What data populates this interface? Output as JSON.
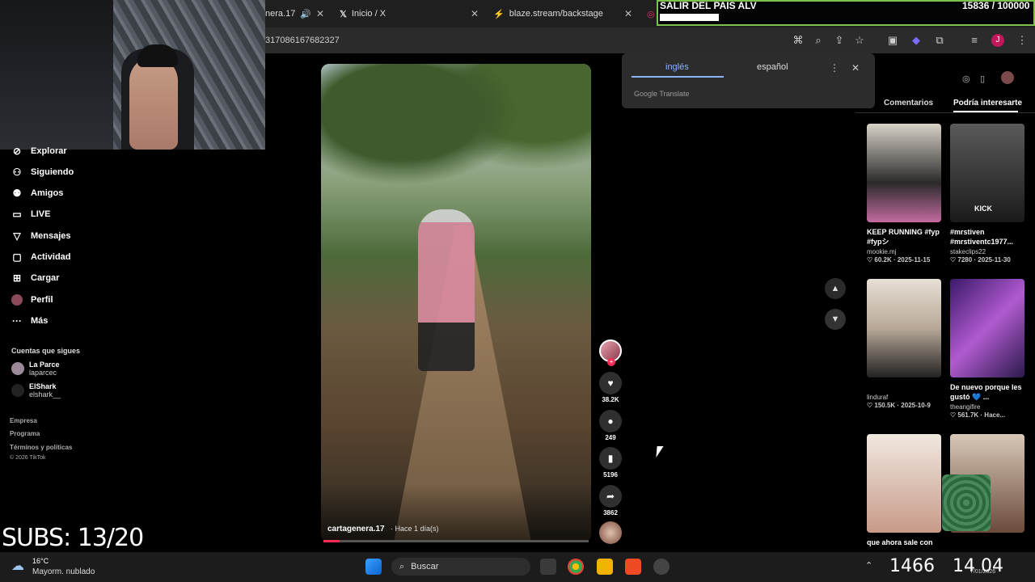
{
  "browser": {
    "tabs": [
      {
        "label": "nera.17",
        "icon": "speaker-icon"
      },
      {
        "label": "Inicio / X",
        "icon": "x-logo-icon"
      },
      {
        "label": "blaze.stream/backstage",
        "icon": "bolt-icon"
      }
    ],
    "url": "317086167682327"
  },
  "stream_goal": {
    "title": "SALIR DEL PAIS ALV",
    "count": "15836 / 100000",
    "progress": 0.158
  },
  "sidebar": {
    "items": [
      {
        "label": "Explorar",
        "icon": "compass-icon"
      },
      {
        "label": "Siguiendo",
        "icon": "people-icon"
      },
      {
        "label": "Amigos",
        "icon": "friends-icon"
      },
      {
        "label": "LIVE",
        "icon": "live-icon"
      },
      {
        "label": "Mensajes",
        "icon": "send-icon"
      },
      {
        "label": "Actividad",
        "icon": "bell-icon"
      },
      {
        "label": "Cargar",
        "icon": "plus-square-icon"
      },
      {
        "label": "Perfil",
        "icon": "profile-icon"
      },
      {
        "label": "Más",
        "icon": "more-icon"
      }
    ],
    "following_title": "Cuentas que sigues",
    "following": [
      {
        "name": "La Parce",
        "handle": "laparcec"
      },
      {
        "name": "ElShark",
        "handle": "elshark__"
      }
    ],
    "footer": [
      "Empresa",
      "Programa",
      "Términos y políticas",
      "© 2026 TikTok"
    ]
  },
  "overlay": {
    "subs": "SUBS: 13/20"
  },
  "video": {
    "author": "cartagenera.17",
    "time": "· Hace 1 día(s)",
    "progress": 0.06
  },
  "actions": {
    "likes": "38.2K",
    "comments": "249",
    "saves": "5196",
    "shares": "3862"
  },
  "translate": {
    "tab_source": "inglés",
    "tab_target": "español",
    "brand": "Google Translate"
  },
  "right_panel": {
    "tab_comments": "Comentarios",
    "tab_suggested": "Podría interesarte",
    "cards": [
      {
        "title": "KEEP RUNNING #fyp #fypシ",
        "user": "mookie.mj",
        "meta": "♡ 60.2K · 2025-11-15"
      },
      {
        "title": "#mrstiven #mrstiventc1977...",
        "user": "stakeclips22",
        "meta": "♡ 7280 · 2025-11-30"
      },
      {
        "title": "",
        "user": "linduraf",
        "meta": "♡ 150.5K · 2025-10-9"
      },
      {
        "title": "De nuevo porque les gustó 💙 ...",
        "user": "theangifire",
        "meta": "♡ 561.7K · Hace..."
      },
      {
        "title": "que ahora sale con",
        "user": "",
        "meta": ""
      },
      {
        "title": "",
        "user": "",
        "meta": ""
      }
    ]
  },
  "taskbar": {
    "weather_temp": "16°C",
    "weather_desc": "Mayorm. nublado",
    "search_placeholder": "Buscar",
    "clock_left": "1466",
    "clock_right": "14 04",
    "date": "7/01/2026"
  }
}
